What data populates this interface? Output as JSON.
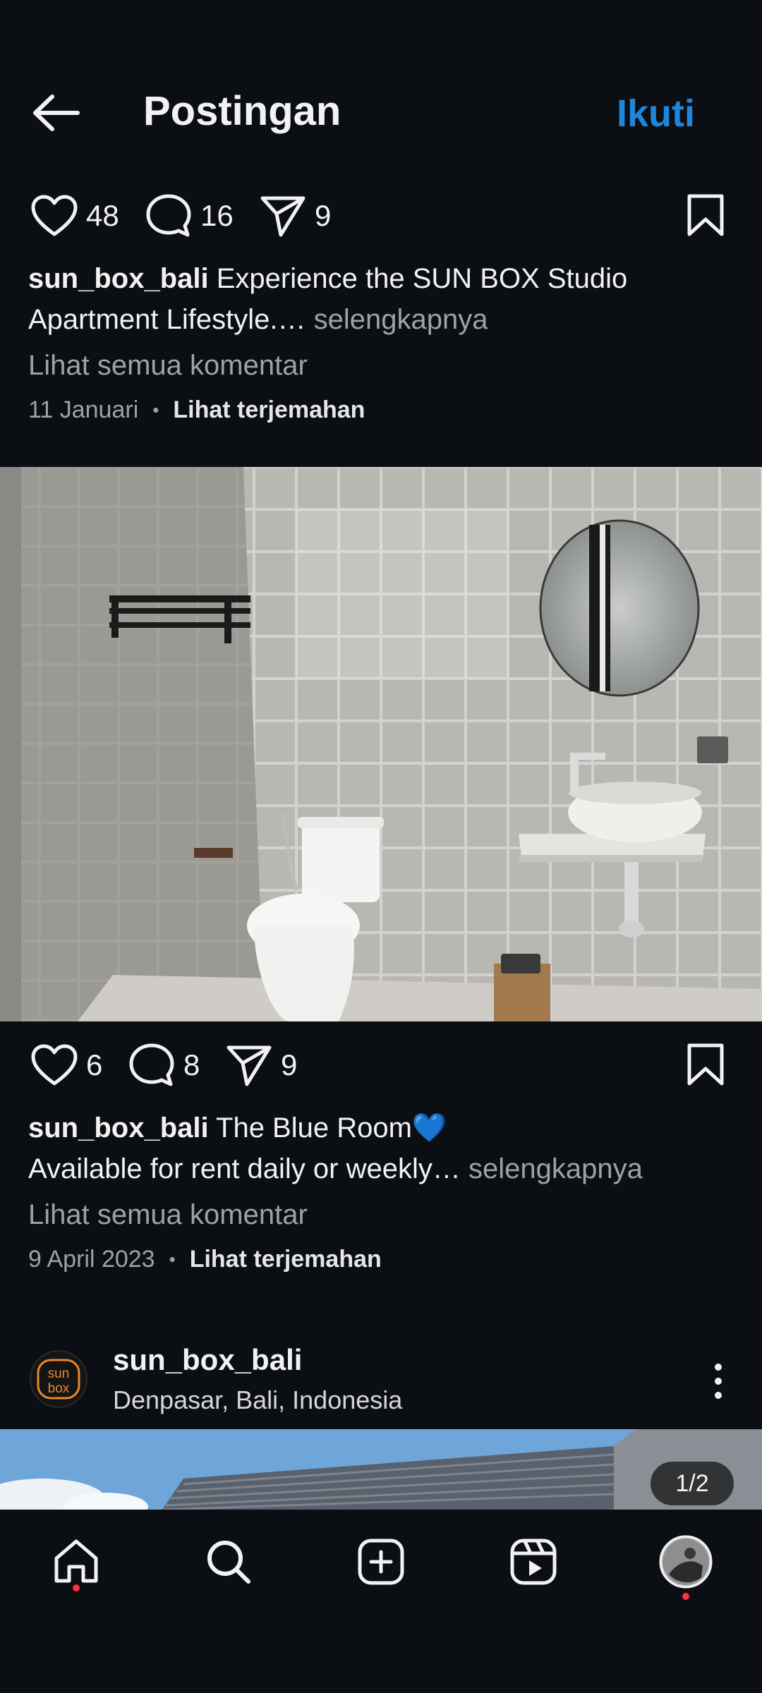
{
  "header": {
    "title": "Postingan",
    "follow_label": "Ikuti"
  },
  "post1": {
    "likes": "48",
    "comments": "16",
    "shares": "9",
    "username": "sun_box_bali",
    "caption_line1": "Experience the SUN BOX Studio",
    "caption_line2": "Apartment Lifestyle.…",
    "more_label": "selengkapnya",
    "view_comments": "Lihat semua komentar",
    "date": "11 Januari",
    "dot": "•",
    "translate": "Lihat terjemahan"
  },
  "post2": {
    "likes": "6",
    "comments": "8",
    "shares": "9",
    "username": "sun_box_bali",
    "caption_line1": "The Blue Room💙",
    "caption_line2": "Available for rent daily or weekly…",
    "more_label": "selengkapnya",
    "view_comments": "Lihat semua komentar",
    "date": "9 April 2023",
    "dot": "•",
    "translate": "Lihat terjemahan"
  },
  "post3": {
    "username": "sun_box_bali",
    "location": "Denpasar, Bali, Indonesia",
    "avatar_text_top": "sun",
    "avatar_text_bottom": "box",
    "image_counter": "1/2"
  },
  "navbar": {
    "items": [
      "home-icon",
      "search-icon",
      "create-icon",
      "reels-icon",
      "profile-avatar"
    ]
  },
  "colors": {
    "accent": "#1f86d9",
    "background": "#0b0e13",
    "notification": "#ff3040",
    "brand_orange": "#e8892a"
  }
}
